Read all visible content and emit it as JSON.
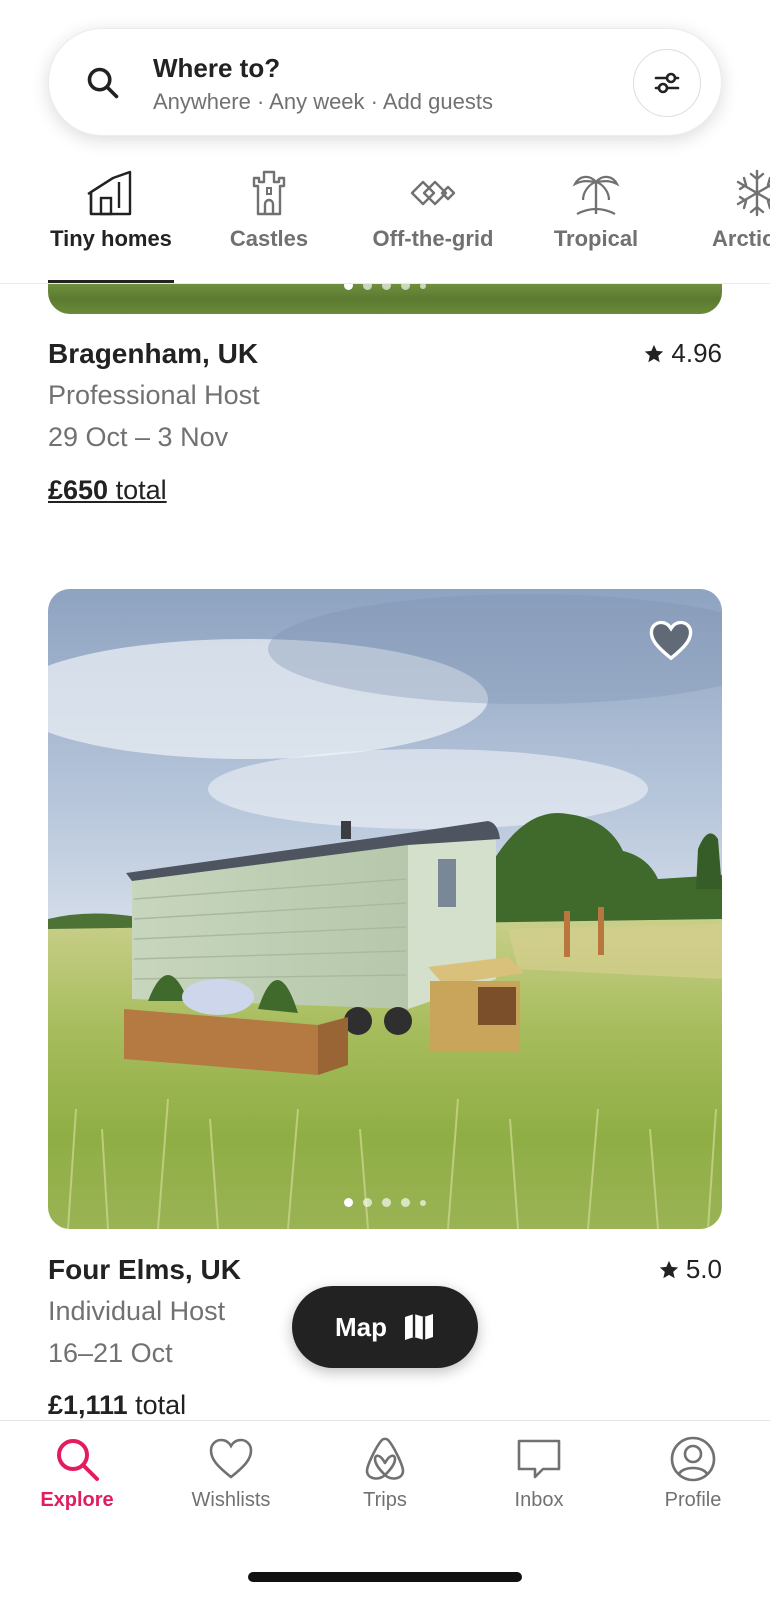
{
  "search": {
    "title": "Where to?",
    "subtitle": "Anywhere · Any week · Add guests",
    "icon": "search-icon",
    "filter_icon": "filters-icon"
  },
  "categories": [
    {
      "label": "Tiny homes",
      "icon": "tiny-home-icon",
      "active": true
    },
    {
      "label": "Castles",
      "icon": "castle-icon",
      "active": false
    },
    {
      "label": "Off-the-grid",
      "icon": "off-grid-icon",
      "active": false
    },
    {
      "label": "Tropical",
      "icon": "palm-tree-icon",
      "active": false
    },
    {
      "label": "Arctic",
      "icon": "snowflake-icon",
      "active": false
    }
  ],
  "listings": [
    {
      "location": "Bragenham, UK",
      "rating": "4.96",
      "host": "Professional Host",
      "dates": "29 Oct – 3 Nov",
      "price": "£650",
      "price_suffix": " total",
      "photo_count": 5,
      "photo_index": 0
    },
    {
      "location": "Four Elms, UK",
      "rating": "5.0",
      "host": "Individual Host",
      "dates": "16–21 Oct",
      "price": "£1,111",
      "price_suffix": " total",
      "photo_count": 5,
      "photo_index": 0,
      "wishlisted": false
    }
  ],
  "map_button": {
    "label": "Map",
    "icon": "map-icon"
  },
  "bottom_nav": [
    {
      "label": "Explore",
      "icon": "search-icon",
      "active": true
    },
    {
      "label": "Wishlists",
      "icon": "heart-icon",
      "active": false
    },
    {
      "label": "Trips",
      "icon": "airbnb-logo-icon",
      "active": false
    },
    {
      "label": "Inbox",
      "icon": "message-icon",
      "active": false
    },
    {
      "label": "Profile",
      "icon": "user-circle-icon",
      "active": false
    }
  ],
  "colors": {
    "accent": "#e31c5f",
    "text_primary": "#222222",
    "text_secondary": "#717171",
    "map_button_bg": "#222222"
  }
}
